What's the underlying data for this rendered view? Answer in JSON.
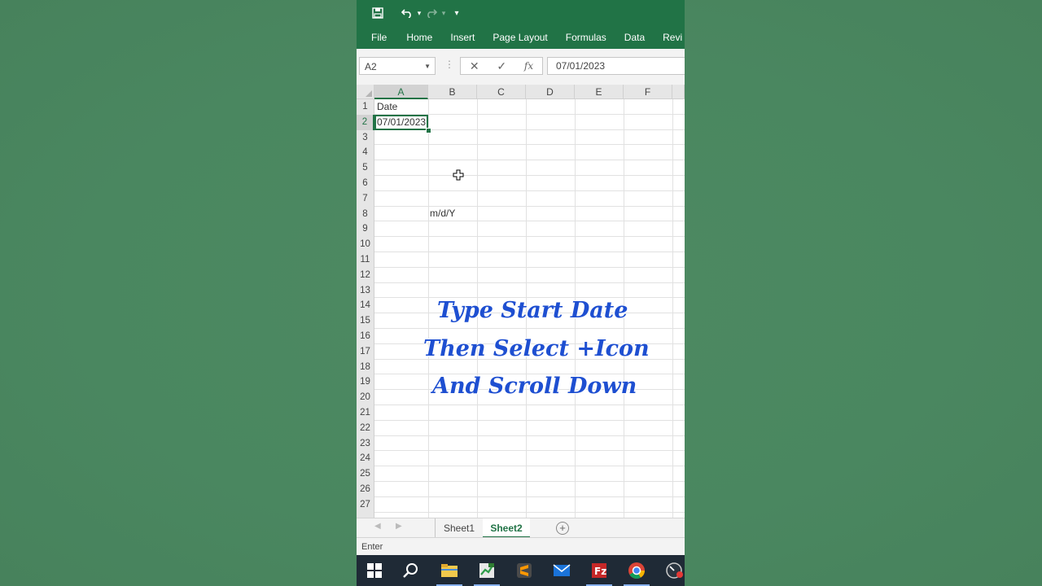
{
  "quick_access": {
    "undo_dropdown": "▾",
    "redo_dropdown": "▾",
    "customize": "▾"
  },
  "ribbon": {
    "tabs": [
      "File",
      "Home",
      "Insert",
      "Page Layout",
      "Formulas",
      "Data",
      "Revi"
    ]
  },
  "formula_bar": {
    "name_box": "A2",
    "cancel": "✕",
    "enter": "✓",
    "fx": "fx",
    "value": "07/01/2023"
  },
  "grid": {
    "columns": [
      "A",
      "B",
      "C",
      "D",
      "E",
      "F"
    ],
    "rows": [
      "1",
      "2",
      "3",
      "4",
      "5",
      "6",
      "7",
      "8",
      "9",
      "10",
      "11",
      "12",
      "13",
      "14",
      "15",
      "16",
      "17",
      "18",
      "19",
      "20",
      "21",
      "22",
      "23",
      "24",
      "25",
      "26",
      "27"
    ],
    "cells": {
      "A1": "Date",
      "A2": "07/01/2023",
      "B8": "m/d/Y"
    },
    "selected_column": "A",
    "selected_row": "2"
  },
  "overlay": {
    "line1": "Type Start Date",
    "line2": "Then Select +Icon",
    "line3": "And Scroll Down",
    "color": "#1e4fd1"
  },
  "sheets": {
    "tabs": [
      "Sheet1",
      "Sheet2"
    ],
    "active": "Sheet2",
    "add_symbol": "+"
  },
  "status": {
    "mode": "Enter"
  },
  "colors": {
    "excel_green": "#217346",
    "taskbar": "#1f2a36"
  },
  "taskbar": {
    "icons": [
      "windows-start-icon",
      "search-icon",
      "file-explorer-icon",
      "project-app-icon",
      "sublime-text-icon",
      "mail-icon",
      "filezilla-icon",
      "chrome-icon",
      "resource-monitor-icon"
    ]
  }
}
